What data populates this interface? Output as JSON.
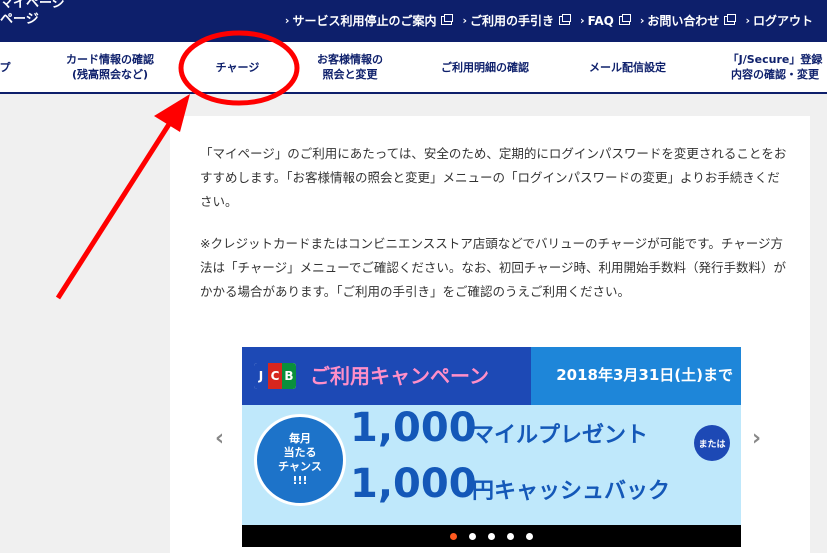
{
  "header": {
    "brand_line1": "マイページ",
    "brand_line2": "ページ",
    "utility_links": [
      {
        "label": "サービス利用停止のご案内",
        "external": true
      },
      {
        "label": "ご利用の手引き",
        "external": true
      },
      {
        "label": "FAQ",
        "external": true
      },
      {
        "label": "お問い合わせ",
        "external": true
      },
      {
        "label": "ログアウト",
        "external": false
      }
    ]
  },
  "nav": {
    "items": [
      {
        "label": "プ"
      },
      {
        "label": "カード情報の確認\n(残高照会など)"
      },
      {
        "label": "チャージ"
      },
      {
        "label": "お客様情報の\n照会と変更"
      },
      {
        "label": "ご利用明細の確認"
      },
      {
        "label": "メール配信設定"
      },
      {
        "label": "「J/Secure」登録\n内容の確認・変更"
      }
    ]
  },
  "content": {
    "paragraph1": "「マイページ」のご利用にあたっては、安全のため、定期的にログインパスワードを変更されることをおすすめします。「お客様情報の照会と変更」メニューの「ログインパスワードの変更」よりお手続きください。",
    "paragraph2": "※クレジットカードまたはコンビニエンスストア店頭などでバリューのチャージが可能です。チャージ方法は「チャージ」メニューでご確認ください。なお、初回チャージ時、利用開始手数料（発行手数料）がかかる場合があります。「ご利用の手引き」をご確認のうえご利用ください。"
  },
  "banner": {
    "logo_letters": [
      "J",
      "C",
      "B"
    ],
    "campaign": "ご利用キャンペーン",
    "until": "2018年3月31日(土)まで",
    "circle_text": "毎月\n当たる\nチャンス\n!!!",
    "line1_amount": "1,000",
    "line1_text": "マイルプレゼント",
    "or_badge": "または",
    "line2_amount": "1,000",
    "line2_text": "円キャッシュバック",
    "slide_count": 5,
    "active_slide": 0
  },
  "carousel": {
    "prev_icon": "chevron-left-icon",
    "next_icon": "chevron-right-icon"
  },
  "annotation": {
    "color": "#ff0000"
  },
  "colors": {
    "navy": "#0d1f6b",
    "jcb_blue": "#1d49b5",
    "jcb_red": "#d7261e",
    "jcb_green": "#0a8f3c"
  }
}
